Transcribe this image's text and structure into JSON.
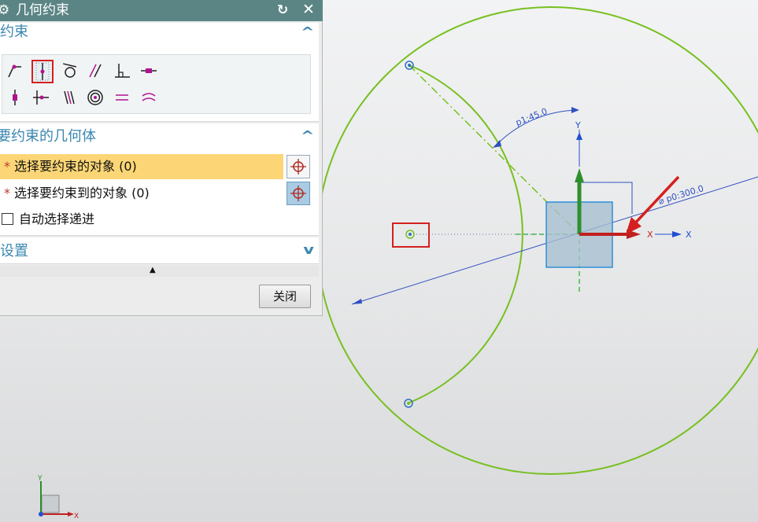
{
  "dialog": {
    "title": "几何约束",
    "icons": [
      "gear-icon",
      "reset-icon",
      "close-icon"
    ]
  },
  "constraints_group": {
    "header": "约束",
    "tools": [
      "coincident",
      "point-on-curve",
      "tangent",
      "parallel",
      "perpendicular",
      "horizontal",
      "vertical",
      "midpoint",
      "collinear",
      "concentric",
      "equal-length",
      "equal-radius"
    ],
    "selected_tool": "point-on-curve"
  },
  "geometry_group": {
    "header": "要约束的几何体",
    "select_object": "选择要约束的对象 (0)",
    "select_target": "选择要约束到的对象 (0)",
    "auto_advance": "自动选择递进",
    "required_mark": "*",
    "auto_advance_checked": false
  },
  "settings_group": {
    "header": "设置"
  },
  "close_button": "关闭",
  "sketch": {
    "angle_dim": "p1:45.0",
    "diameter_dim": "⌀ p0:300.0",
    "axis_x": "X",
    "axis_y": "Y",
    "colors": {
      "curve": "#77c020",
      "dimension": "#3050c0",
      "red": "#d42020",
      "block": "#a8bfd0"
    }
  }
}
